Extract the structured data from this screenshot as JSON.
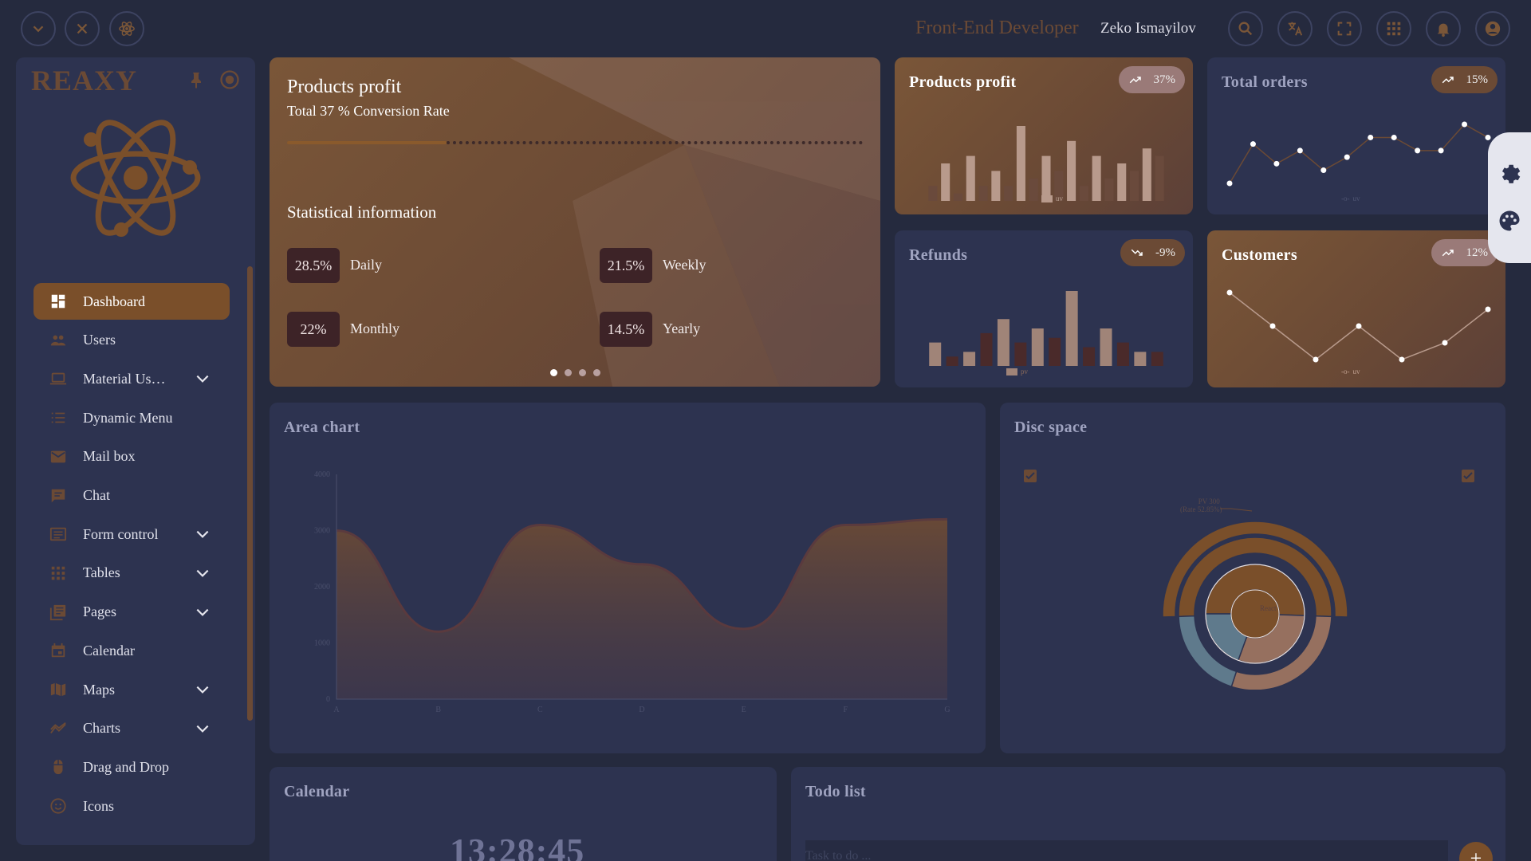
{
  "header": {
    "role": "Front-End Developer",
    "user_name": "Zeko Ismayilov"
  },
  "sidebar": {
    "brand": "REAXY",
    "items": [
      {
        "label": "Dashboard",
        "icon": "dashboard-icon",
        "active": true,
        "expandable": false
      },
      {
        "label": "Users",
        "icon": "users-icon",
        "active": false,
        "expandable": false
      },
      {
        "label": "Material Us…",
        "icon": "laptop-icon",
        "active": false,
        "expandable": true
      },
      {
        "label": "Dynamic Menu",
        "icon": "list-icon",
        "active": false,
        "expandable": false
      },
      {
        "label": "Mail box",
        "icon": "mail-icon",
        "active": false,
        "expandable": false
      },
      {
        "label": "Chat",
        "icon": "chat-icon",
        "active": false,
        "expandable": false
      },
      {
        "label": "Form control",
        "icon": "form-icon",
        "active": false,
        "expandable": true
      },
      {
        "label": "Tables",
        "icon": "grid-icon",
        "active": false,
        "expandable": true
      },
      {
        "label": "Pages",
        "icon": "pages-icon",
        "active": false,
        "expandable": true
      },
      {
        "label": "Calendar",
        "icon": "calendar-icon",
        "active": false,
        "expandable": false
      },
      {
        "label": "Maps",
        "icon": "map-icon",
        "active": false,
        "expandable": true
      },
      {
        "label": "Charts",
        "icon": "chart-icon",
        "active": false,
        "expandable": true
      },
      {
        "label": "Drag and Drop",
        "icon": "mouse-icon",
        "active": false,
        "expandable": false
      },
      {
        "label": "Icons",
        "icon": "smiley-icon",
        "active": false,
        "expandable": false
      }
    ]
  },
  "hero": {
    "title": "Products profit",
    "subtitle": "Total 37 % Conversion Rate",
    "progress_fraction": 0.37,
    "stats_title": "Statistical information",
    "stats": [
      {
        "value": "28.5%",
        "label": "Daily"
      },
      {
        "value": "21.5%",
        "label": "Weekly"
      },
      {
        "value": "22%",
        "label": "Monthly"
      },
      {
        "value": "14.5%",
        "label": "Yearly"
      }
    ],
    "carousel_active": 0,
    "carousel_count": 4
  },
  "mini_cards": {
    "products_profit": {
      "title": "Products profit",
      "badge": "37%",
      "trend": "up",
      "legend": "uv"
    },
    "total_orders": {
      "title": "Total orders",
      "badge": "15%",
      "trend": "up",
      "legend": "uv"
    },
    "refunds": {
      "title": "Refunds",
      "badge": "-9%",
      "trend": "down",
      "legend": "pv"
    },
    "customers": {
      "title": "Customers",
      "badge": "12%",
      "trend": "up",
      "legend": "uv"
    }
  },
  "area_chart": {
    "title": "Area chart"
  },
  "disc_space": {
    "title": "Disc space",
    "tooltip_line1": "PV 300",
    "tooltip_line2": "(Rate 52.85%)",
    "center_label": "React"
  },
  "calendar": {
    "title": "Calendar",
    "time": "13:28:45"
  },
  "todo": {
    "title": "Todo list",
    "placeholder": "Task to do ..."
  },
  "colors": {
    "background": "#252a3e",
    "card": "#2d3350",
    "accent": "#7a4f2a",
    "accent_dark": "#3d2327",
    "area_fill": "#6b4a35",
    "slate_blue": "#5f7a8c"
  },
  "chart_data": [
    {
      "type": "bar",
      "title": "Products profit",
      "series": [
        {
          "name": "uv",
          "values": [
            2,
            5,
            1,
            6,
            2,
            4,
            2,
            10,
            3,
            6,
            4,
            8,
            2,
            6,
            3,
            5,
            4,
            7,
            6
          ]
        }
      ]
    },
    {
      "type": "line",
      "title": "Total orders",
      "series": [
        {
          "name": "uv",
          "values": [
            3,
            9,
            6,
            8,
            5,
            7,
            10,
            10,
            8,
            8,
            12,
            10
          ]
        }
      ]
    },
    {
      "type": "bar",
      "title": "Refunds",
      "series": [
        {
          "name": "pv",
          "values": [
            5,
            2,
            3,
            7,
            10,
            5,
            8,
            6,
            16,
            4,
            8,
            5,
            3,
            3
          ]
        }
      ]
    },
    {
      "type": "line",
      "title": "Customers",
      "series": [
        {
          "name": "uv",
          "values": [
            10,
            8,
            6,
            8,
            6,
            7,
            9
          ]
        }
      ]
    },
    {
      "type": "area",
      "title": "Area chart",
      "categories": [
        "A",
        "B",
        "C",
        "D",
        "E",
        "F",
        "G"
      ],
      "series": [
        {
          "values": [
            3000,
            1200,
            3100,
            2400,
            1250,
            3100,
            3200
          ]
        }
      ],
      "yticks": [
        "0",
        "1000",
        "2000",
        "3000",
        "4000"
      ],
      "ylim": [
        0,
        4000
      ]
    },
    {
      "type": "pie",
      "title": "Disc space",
      "rings": [
        {
          "name": "outer",
          "slices": [
            {
              "label": "React",
              "value": 52.85,
              "color": "#7a4f2a"
            }
          ]
        },
        {
          "name": "middle",
          "slices": [
            {
              "value": 30,
              "color": "#7a4f2a"
            },
            {
              "value": 45,
              "color": "#96705f"
            },
            {
              "value": 25,
              "color": "#5f7a8c"
            }
          ]
        },
        {
          "name": "inner",
          "slices": [
            {
              "value": 50,
              "color": "#7a4f2a"
            },
            {
              "value": 30,
              "color": "#96705f"
            },
            {
              "value": 20,
              "color": "#5f7a8c"
            }
          ]
        }
      ]
    }
  ]
}
